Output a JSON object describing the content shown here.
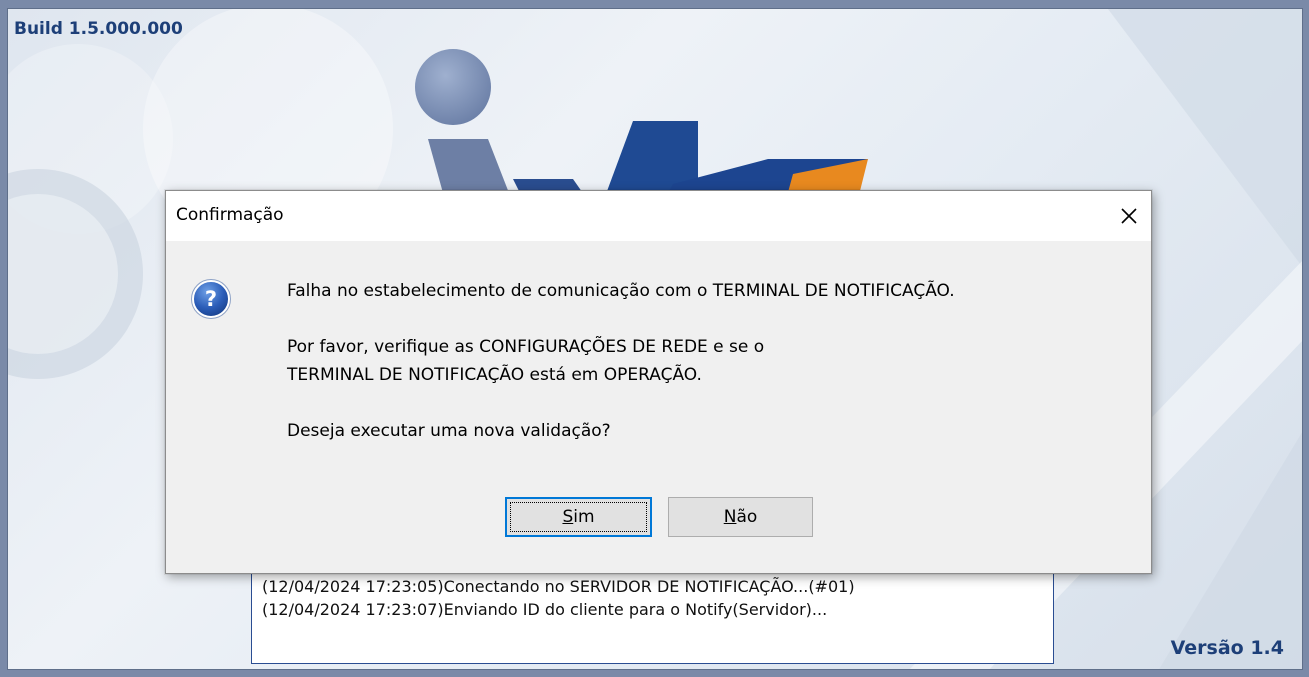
{
  "splash": {
    "build": "Build 1.5.000.000",
    "version": "Versão 1.4",
    "log_lines": [
      "(12/04/2024 17:23:05)Conectando no SERVIDOR DE NOTIFICAÇÃO...(#01)",
      "(12/04/2024 17:23:07)Enviando ID do cliente para o Notify(Servidor)..."
    ]
  },
  "dialog": {
    "title": "Confirmação",
    "close_icon": "close-icon",
    "icon": "question-icon",
    "lines": [
      "Falha no estabelecimento de comunicação com o TERMINAL DE NOTIFICAÇÃO.",
      "Por favor, verifique as CONFIGURAÇÕES DE REDE e se o",
      "TERMINAL DE NOTIFICAÇÃO está em OPERAÇÃO.",
      "Deseja executar uma nova validação?"
    ],
    "buttons": {
      "yes_mnemonic": "S",
      "yes_rest": "im",
      "no_mnemonic": "N",
      "no_rest": "ão"
    }
  },
  "colors": {
    "brand_blue": "#1d3f78",
    "brand_orange": "#e8891f",
    "focus_blue": "#0078d7"
  }
}
